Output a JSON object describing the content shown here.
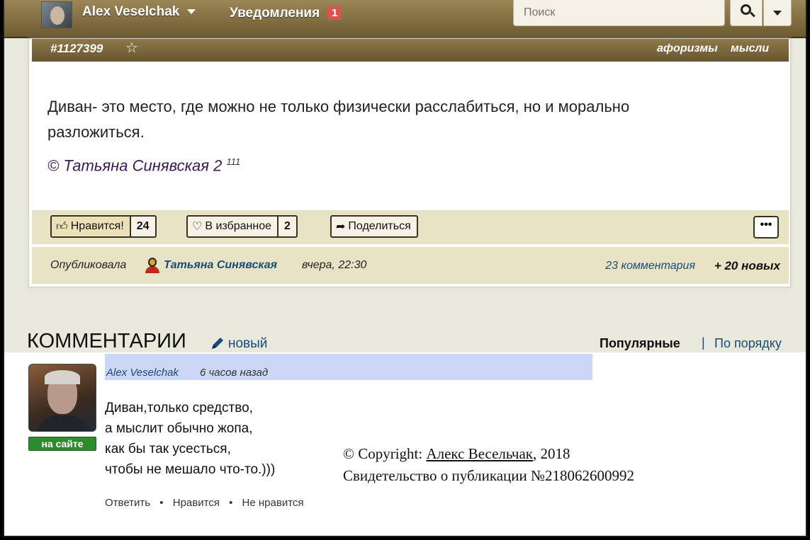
{
  "topbar": {
    "user_name": "Alex Veselchak",
    "notifications_label": "Уведомления",
    "notifications_count": "1",
    "search_placeholder": "Поиск"
  },
  "post": {
    "id": "#1127399",
    "tags": [
      "афоризмы",
      "мысли"
    ],
    "text": "Диван- это место, где можно не только физически расслабиться, но и морально разложиться.",
    "copyright_sign": "©",
    "author_link": "Татьяна Синявская 2",
    "author_sup": "111",
    "actions": {
      "like_label": "Нравится!",
      "like_count": "24",
      "fav_label": "В избранное",
      "fav_count": "2",
      "share_label": "Поделиться",
      "more_label": "•••"
    },
    "meta": {
      "published_label": "Опубликовала",
      "author": "Татьяна Синявская",
      "time": "вчера, 22:30",
      "comments": "23 комментария",
      "new": "+ 20 новых"
    }
  },
  "comments_section": {
    "title": "КОММЕНТАРИИ",
    "new_label": "новый",
    "sort_popular": "Популярные",
    "sort_separator": "|",
    "sort_order": "По порядку"
  },
  "comment": {
    "author": "Alex Veselchak",
    "time": "6 часов назад",
    "online_badge": "на сайте",
    "lines": [
      "Диван,только средство,",
      "а мыслит обычно жопа,",
      "как бы так усесться,",
      "чтобы не мешало что-то.)))"
    ],
    "reply": "Ответить",
    "like": "Нравится",
    "dislike": "Не нравится",
    "separator": "•"
  },
  "copyright": {
    "prefix": "© Copyright:",
    "author": "Алекс Весельчак",
    "year": ", 2018",
    "certificate": "Свидетельство о публикации №218062600992"
  }
}
